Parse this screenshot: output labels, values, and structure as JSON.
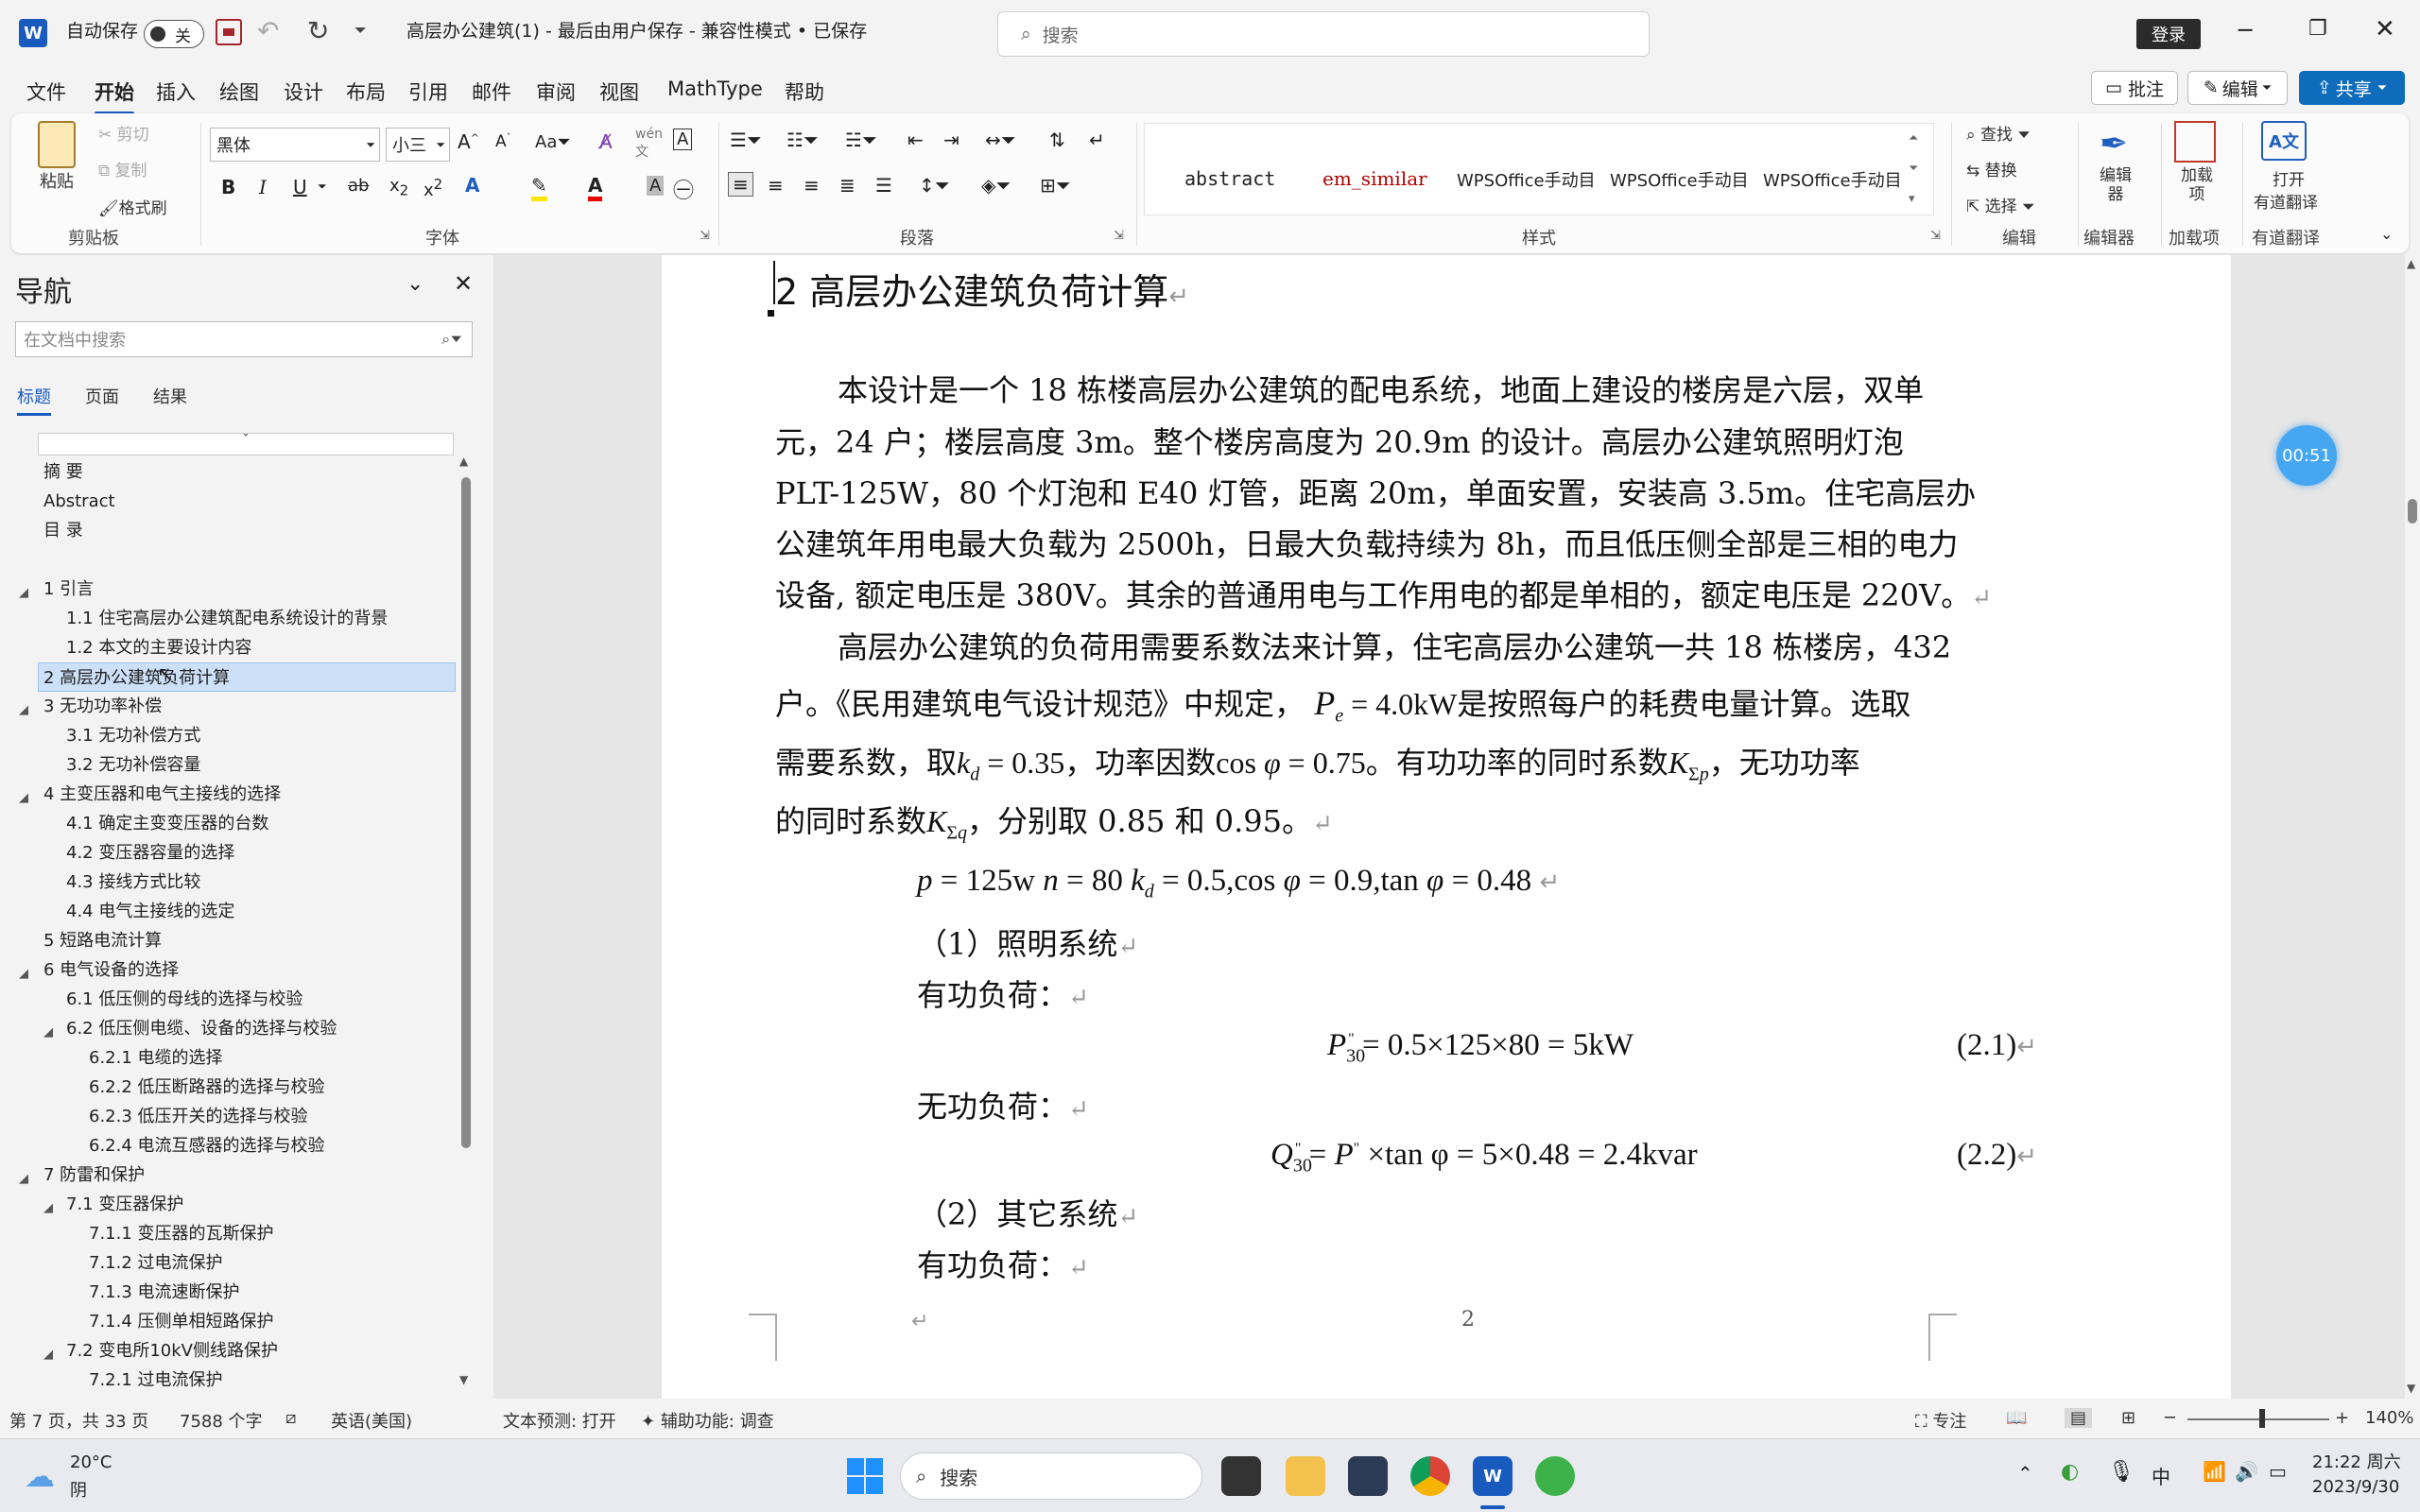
{
  "titlebar": {
    "autosave_label": "自动保存",
    "autosave_state": "关",
    "doc_title": "高层办公建筑(1) - 最后由用户保存 - 兼容性模式 • 已保存",
    "search_placeholder": "搜索",
    "login_label": "登录"
  },
  "menu": {
    "items": [
      "文件",
      "开始",
      "插入",
      "绘图",
      "设计",
      "布局",
      "引用",
      "邮件",
      "审阅",
      "视图",
      "MathType",
      "帮助"
    ],
    "active": "开始",
    "comments_label": "批注",
    "edit_label": "编辑",
    "share_label": "共享"
  },
  "ribbon": {
    "clipboard": {
      "paste": "粘贴",
      "cut": "剪切",
      "copy": "复制",
      "format_painter": "格式刷",
      "label": "剪贴板"
    },
    "font": {
      "family": "黑体",
      "size": "小三",
      "label": "字体"
    },
    "paragraph": {
      "label": "段落"
    },
    "styles": {
      "items": [
        "abstract",
        "em_similar",
        "WPSOffice手动目",
        "WPSOffice手动目",
        "WPSOffice手动目"
      ],
      "label": "样式"
    },
    "editing": {
      "find": "查找",
      "replace": "替换",
      "select": "选择",
      "label": "编辑"
    },
    "editor": {
      "button": "编辑器",
      "label": "编辑器"
    },
    "addins": {
      "button": "加载项",
      "label": "加载项"
    },
    "translate": {
      "button_line1": "打开",
      "button_line2": "有道翻译",
      "label": "有道翻译"
    }
  },
  "nav": {
    "title": "导航",
    "search_placeholder": "在文档中搜索",
    "tabs": [
      "标题",
      "页面",
      "结果"
    ],
    "active_tab": "标题",
    "items": [
      {
        "text": "摘    要"
      },
      {
        "text": "Abstract"
      },
      {
        "text": "目    录"
      },
      {
        "text": "1 引言"
      },
      {
        "text": "1.1 住宅高层办公建筑配电系统设计的背景"
      },
      {
        "text": "1.2 本文的主要设计内容"
      },
      {
        "text": "2 高层办公建筑负荷计算"
      },
      {
        "text": "3 无功功率补偿"
      },
      {
        "text": "3.1 无功补偿方式"
      },
      {
        "text": "3.2 无功补偿容量"
      },
      {
        "text": "4 主变压器和电气主接线的选择"
      },
      {
        "text": "4.1 确定主变变压器的台数"
      },
      {
        "text": "4.2 变压器容量的选择"
      },
      {
        "text": "4.3 接线方式比较"
      },
      {
        "text": "4.4 电气主接线的选定"
      },
      {
        "text": "5 短路电流计算"
      },
      {
        "text": "6 电气设备的选择"
      },
      {
        "text": "6.1 低压侧的母线的选择与校验"
      },
      {
        "text": "6.2 低压侧电缆、设备的选择与校验"
      },
      {
        "text": "6.2.1 电缆的选择"
      },
      {
        "text": "6.2.2 低压断路器的选择与校验"
      },
      {
        "text": "6.2.3 低压开关的选择与校验"
      },
      {
        "text": "6.2.4 电流互感器的选择与校验"
      },
      {
        "text": "7 防雷和保护"
      },
      {
        "text": "7.1 变压器保护"
      },
      {
        "text": "7.1.1 变压器的瓦斯保护"
      },
      {
        "text": "7.1.2 过电流保护"
      },
      {
        "text": "7.1.3 电流速断保护"
      },
      {
        "text": "7.1.4 压侧单相短路保护"
      },
      {
        "text": "7.2 变电所10kV侧线路保护"
      },
      {
        "text": "7.2.1 过电流保护"
      }
    ]
  },
  "document": {
    "heading": "2  高层办公建筑负荷计算",
    "para1": [
      "本设计是一个 18 栋楼高层办公建筑的配电系统，地面上建设的楼房是六层，双单",
      "元，24  户；楼层高度  3m。整个楼房高度为  20.9m  的设计。高层办公建筑照明灯泡",
      "PLT-125W，80 个灯泡和 E40 灯管，距离 20m，单面安置，安装高 3.5m。住宅高层办",
      "公建筑年用电最大负载为 2500h，日最大负载持续为 8h，而且低压侧全部是三相的电力",
      "设备, 额定电压是 380V。其余的普通用电与工作用电的都是单相的，额定电压是 220V。"
    ],
    "para2_line1": "高层办公建筑的负荷用需要系数法来计算，住宅高层办公建筑一共 18 栋楼房，432",
    "para2_line2a": "户。《民用建筑电气设计规范》中规定，",
    "para2_line2b": "是按照每户的耗费电量计算。选取",
    "para2_line3a": "需要系数，取",
    "para2_line3b": "，功率因数",
    "para2_line3c": "。有功功率的同时系数",
    "para2_line3d": "，无功功率",
    "para2_line4a": "的同时系数",
    "para2_line4b": "，分别取 0.85 和 0.95。",
    "params_line": "p = 125w  n = 80  k",
    "lighting": "（1）照明系统",
    "active_load": "有功负荷：",
    "eq1_rhs": "= 0.5×125×80 = 5kW",
    "eq1_num": "(2.1)",
    "reactive_load": "无功负荷：",
    "eq2_rhs": "×tan φ = 5×0.48 = 2.4kvar",
    "eq2_num": "(2.2)",
    "other": "（2）其它系统",
    "active_load2": "有功负荷：",
    "page_number": "2"
  },
  "timer": "00:51",
  "status": {
    "page": "第 7 页，共 33 页",
    "words": "7588 个字",
    "language": "英语(美国)",
    "prediction": "文本预测: 打开",
    "accessibility": "辅助功能: 调查",
    "focus": "专注",
    "zoom": "140%"
  },
  "taskbar": {
    "weather_temp": "20°C",
    "weather_desc": "阴",
    "search": "搜索",
    "ime": "中",
    "time": "21:22 周六",
    "date": "2023/9/30"
  },
  "colors": {
    "accent": "#185abd",
    "share": "#0f6cbd",
    "selection": "#cce0f8"
  }
}
